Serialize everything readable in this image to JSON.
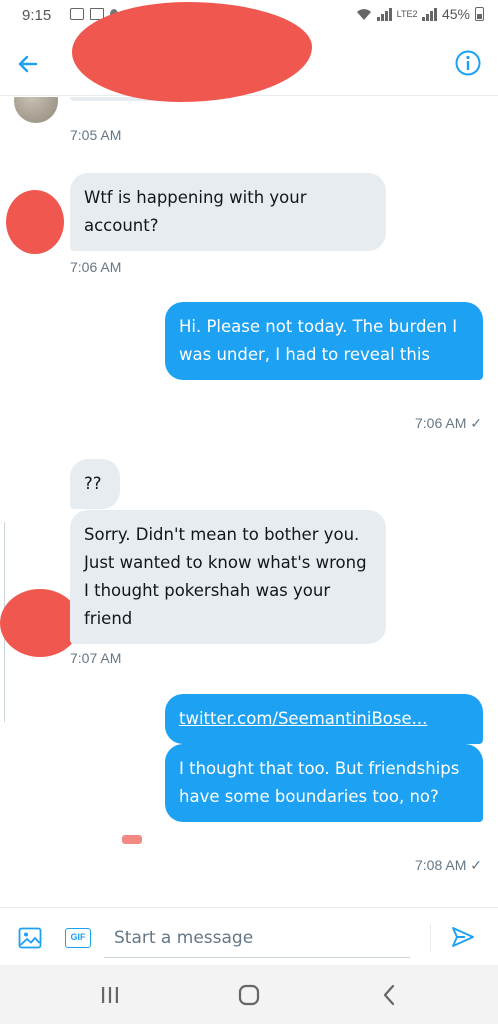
{
  "status_bar": {
    "time": "9:15",
    "network": "LTE2",
    "battery": "45%",
    "icons": [
      "image-icon",
      "mail-icon",
      "notification-icon",
      "wifi-icon",
      "signal-icon",
      "signal-icon",
      "battery-icon"
    ]
  },
  "header": {
    "back_icon": "arrow-left-icon",
    "title": "",
    "info_icon": "info-icon",
    "accent_color": "#1da1f2"
  },
  "messages": [
    {
      "side": "in",
      "text": "",
      "time": "7:05 AM"
    },
    {
      "side": "in",
      "text": "Wtf is happening with your account?",
      "time": "7:06 AM"
    },
    {
      "side": "out",
      "text": "Hi. Please not today. The burden I was under, I had to reveal this",
      "time": "7:06 AM ✓"
    },
    {
      "side": "in",
      "text": "??",
      "time": ""
    },
    {
      "side": "in",
      "text": "Sorry. Didn't mean to bother you. Just wanted to know what's wrong I thought pokershah was your friend",
      "time": "7:07 AM"
    },
    {
      "side": "out",
      "text": "twitter.com/SeemantiniBose...",
      "time": ""
    },
    {
      "side": "out",
      "text": "I thought that too. But friendships have some boundaries too, no?",
      "time": "7:08 AM ✓"
    }
  ],
  "composer": {
    "placeholder": "Start a message",
    "gif_label": "GIF",
    "image_icon": "image-icon",
    "send_icon": "send-icon"
  },
  "nav": {
    "recent_icon": "recent-apps-icon",
    "home_icon": "home-icon",
    "back_icon": "back-icon"
  },
  "colors": {
    "incoming_bubble": "#e6ecf0",
    "outgoing_bubble": "#1da1f2",
    "redaction": "#f0574f"
  }
}
